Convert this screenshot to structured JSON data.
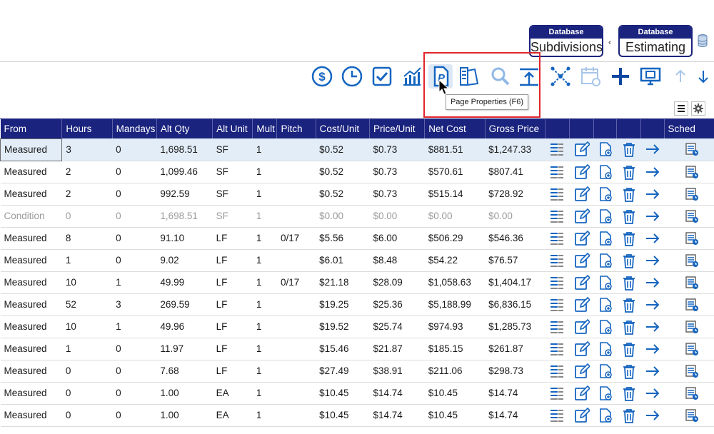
{
  "databases": [
    {
      "caption": "Database",
      "label": "Subdivisions"
    },
    {
      "caption": "Database",
      "label": "Estimating"
    }
  ],
  "pill_separator": "‹",
  "toolbar": {
    "icons": [
      "dollar-icon",
      "clock-icon",
      "checkbox-icon",
      "chart-icon",
      "page-properties-icon",
      "layers-icon",
      "search-icon",
      "upload-icon",
      "network-icon",
      "calendar-icon",
      "plus-icon",
      "monitor-icon",
      "up-arrow-icon",
      "down-arrow-icon"
    ],
    "tooltip": "Page Properties (F6)"
  },
  "colors": {
    "header": "#1a237e",
    "icon": "#1565c0",
    "highlight_box": "#e0262b"
  },
  "table": {
    "columns": [
      "From",
      "Hours",
      "Mandays",
      "Alt Qty",
      "Alt Unit",
      "Mult",
      "Pitch",
      "Cost/Unit",
      "Price/Unit",
      "Net Cost",
      "Gross Price",
      "",
      "",
      "",
      "",
      "",
      "Sched"
    ],
    "rows": [
      [
        "Measured",
        "3",
        "0",
        "1,698.51",
        "SF",
        "1",
        "",
        "$0.52",
        "$0.73",
        "$881.51",
        "$1,247.33"
      ],
      [
        "Measured",
        "2",
        "0",
        "1,099.46",
        "SF",
        "1",
        "",
        "$0.52",
        "$0.73",
        "$570.61",
        "$807.41"
      ],
      [
        "Measured",
        "2",
        "0",
        "992.59",
        "SF",
        "1",
        "",
        "$0.52",
        "$0.73",
        "$515.14",
        "$728.92"
      ],
      [
        "Condition",
        "0",
        "0",
        "1,698.51",
        "SF",
        "1",
        "",
        "$0.00",
        "$0.00",
        "$0.00",
        "$0.00"
      ],
      [
        "Measured",
        "8",
        "0",
        "91.10",
        "LF",
        "1",
        "0/17",
        "$5.56",
        "$6.00",
        "$506.29",
        "$546.36"
      ],
      [
        "Measured",
        "1",
        "0",
        "9.02",
        "LF",
        "1",
        "",
        "$6.01",
        "$8.48",
        "$54.22",
        "$76.57"
      ],
      [
        "Measured",
        "10",
        "1",
        "49.99",
        "LF",
        "1",
        "0/17",
        "$21.18",
        "$28.09",
        "$1,058.63",
        "$1,404.17"
      ],
      [
        "Measured",
        "52",
        "3",
        "269.59",
        "LF",
        "1",
        "",
        "$19.25",
        "$25.36",
        "$5,188.99",
        "$6,836.15"
      ],
      [
        "Measured",
        "10",
        "1",
        "49.96",
        "LF",
        "1",
        "",
        "$19.52",
        "$25.74",
        "$974.93",
        "$1,285.73"
      ],
      [
        "Measured",
        "1",
        "0",
        "11.97",
        "LF",
        "1",
        "",
        "$15.46",
        "$21.87",
        "$185.15",
        "$261.87"
      ],
      [
        "Measured",
        "0",
        "0",
        "7.68",
        "LF",
        "1",
        "",
        "$27.49",
        "$38.91",
        "$211.06",
        "$298.73"
      ],
      [
        "Measured",
        "0",
        "0",
        "1.00",
        "EA",
        "1",
        "",
        "$10.45",
        "$14.74",
        "$10.45",
        "$14.74"
      ],
      [
        "Measured",
        "0",
        "0",
        "1.00",
        "EA",
        "1",
        "",
        "$10.45",
        "$14.74",
        "$10.45",
        "$14.74"
      ]
    ]
  }
}
